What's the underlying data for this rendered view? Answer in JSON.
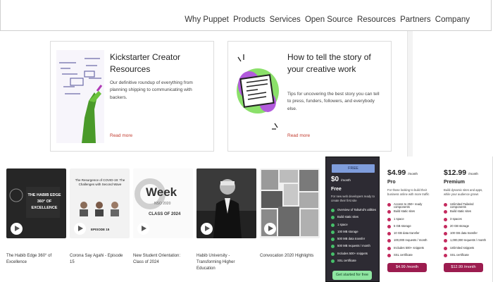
{
  "nav": {
    "links": [
      "Why Puppet",
      "Products",
      "Services",
      "Open Source",
      "Resources",
      "Partners",
      "Company"
    ]
  },
  "cards": [
    {
      "title": "Kickstarter Creator Resources",
      "description": "Our definitive roundup of everything from planning shipping to communicating with backers.",
      "more": "Read more"
    },
    {
      "title": "How to tell the story of your creative work",
      "description": "Tips for uncovering the best story you can tell to press, funders, followers, and everybody else.",
      "more": "Read more"
    }
  ],
  "videos": [
    {
      "title": "The Habib Edge 360° of Excellence",
      "thumb_text": "THE HABIB EDGE 360° OF EXCELLENCE"
    },
    {
      "title": "Corona Say Agahi - Episode 15",
      "thumb_text": "The Resurgence of COVID-19: The Challenges with Second Wave",
      "thumb_sub": "EPISODE 15"
    },
    {
      "title": "New Student Orientation: Class of 2024",
      "thumb_text": "Week",
      "thumb_sub": "NSO 2020",
      "thumb_sub2": "CLASS OF 2024"
    },
    {
      "title": "Habib University - Transforming Higher Education"
    },
    {
      "title": "Convocation 2020 Highlights"
    }
  ],
  "pricing": {
    "free": {
      "tag": "FREE",
      "price": "$0",
      "period": "/month",
      "name": "Free",
      "description": "For new web developers ready to create their first site",
      "features": [
        "Overview of Tailwind's utilities",
        "Build static sites",
        "1 space",
        "100 MB storage",
        "500 MB data transfer",
        "500 MB requests / month",
        "Includes 500+ snippets",
        "SSL certificate"
      ],
      "button": "Get started for free"
    },
    "pro": {
      "price": "$4.99",
      "period": "/month",
      "name": "Pro",
      "description": "For those looking to build their business online with more traffic",
      "features": [
        "Access to 250+ ready components",
        "Build static sites",
        "1 space",
        "5 GB storage",
        "10 GB data transfer",
        "100,000 requests / month",
        "Includes 500+ snippets",
        "SSL certificate"
      ],
      "button": "$4.99 /month"
    },
    "premium": {
      "price": "$12.99",
      "period": "/month",
      "name": "Premium",
      "description": "Build dynamic sites and apps, while your audience grows",
      "features": [
        "Unlimited Tailwind components",
        "Build static sites",
        "3 spaces",
        "20 GB storage",
        "100 GB data transfer",
        "1,000,000 requests / month",
        "Unlimited snippets",
        "SSL certificate"
      ],
      "button": "$12.99 /month"
    }
  }
}
